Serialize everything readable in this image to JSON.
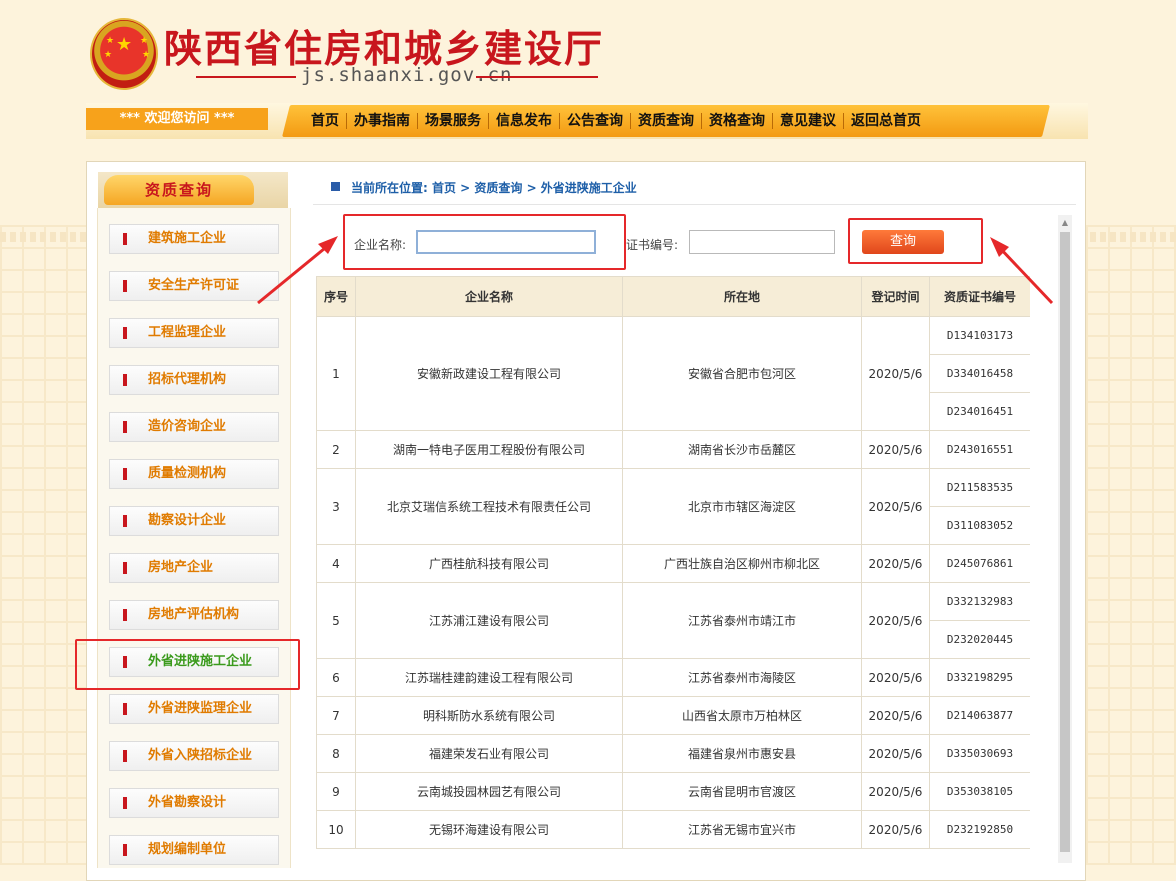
{
  "header": {
    "site_title": "陕西省住房和城乡建设厅",
    "site_url": "js.shaanxi.gov.cn"
  },
  "nav": {
    "welcome": "*** 欢迎您访问 ***",
    "items": [
      "首页",
      "办事指南",
      "场景服务",
      "信息发布",
      "公告查询",
      "资质查询",
      "资格查询",
      "意见建议",
      "返回总首页"
    ]
  },
  "sidebar": {
    "title": "资质查询",
    "items": [
      "建筑施工企业",
      "安全生产许可证",
      "工程监理企业",
      "招标代理机构",
      "造价咨询企业",
      "质量检测机构",
      "勘察设计企业",
      "房地产企业",
      "房地产评估机构",
      "外省进陕施工企业",
      "外省进陕监理企业",
      "外省入陕招标企业",
      "外省勘察设计",
      "规划编制单位"
    ],
    "active_index": 9
  },
  "breadcrumb": {
    "text": "当前所在位置: 首页 > 资质查询 > 外省进陕施工企业"
  },
  "search": {
    "company_label": "企业名称:",
    "company_value": "",
    "cert_label": "证书编号:",
    "cert_value": "",
    "query_button": "查询"
  },
  "table": {
    "headers": [
      "序号",
      "企业名称",
      "所在地",
      "登记时间",
      "资质证书编号"
    ],
    "rows": [
      {
        "no": "1",
        "name": "安徽新政建设工程有限公司",
        "loc": "安徽省合肥市包河区",
        "date": "2020/5/6",
        "certs": [
          "D134103173",
          "D334016458",
          "D234016451"
        ]
      },
      {
        "no": "2",
        "name": "湖南一特电子医用工程股份有限公司",
        "loc": "湖南省长沙市岳麓区",
        "date": "2020/5/6",
        "certs": [
          "D243016551"
        ]
      },
      {
        "no": "3",
        "name": "北京艾瑞信系统工程技术有限责任公司",
        "loc": "北京市市辖区海淀区",
        "date": "2020/5/6",
        "certs": [
          "D211583535",
          "D311083052"
        ]
      },
      {
        "no": "4",
        "name": "广西桂航科技有限公司",
        "loc": "广西壮族自治区柳州市柳北区",
        "date": "2020/5/6",
        "certs": [
          "D245076861"
        ]
      },
      {
        "no": "5",
        "name": "江苏浦江建设有限公司",
        "loc": "江苏省泰州市靖江市",
        "date": "2020/5/6",
        "certs": [
          "D332132983",
          "D232020445"
        ]
      },
      {
        "no": "6",
        "name": "江苏瑞桂建韵建设工程有限公司",
        "loc": "江苏省泰州市海陵区",
        "date": "2020/5/6",
        "certs": [
          "D332198295"
        ]
      },
      {
        "no": "7",
        "name": "明科斯防水系统有限公司",
        "loc": "山西省太原市万柏林区",
        "date": "2020/5/6",
        "certs": [
          "D214063877"
        ]
      },
      {
        "no": "8",
        "name": "福建荣发石业有限公司",
        "loc": "福建省泉州市惠安县",
        "date": "2020/5/6",
        "certs": [
          "D335030693"
        ]
      },
      {
        "no": "9",
        "name": "云南城投园林园艺有限公司",
        "loc": "云南省昆明市官渡区",
        "date": "2020/5/6",
        "certs": [
          "D353038105"
        ]
      },
      {
        "no": "10",
        "name": "无锡环海建设有限公司",
        "loc": "江苏省无锡市宜兴市",
        "date": "2020/5/6",
        "certs": [
          "D232192850"
        ]
      }
    ]
  },
  "colors": {
    "title_red": "#c8161d",
    "nav_orange": "#f39a12",
    "highlight_red": "#e5282a",
    "link_blue": "#1e5fa8"
  }
}
